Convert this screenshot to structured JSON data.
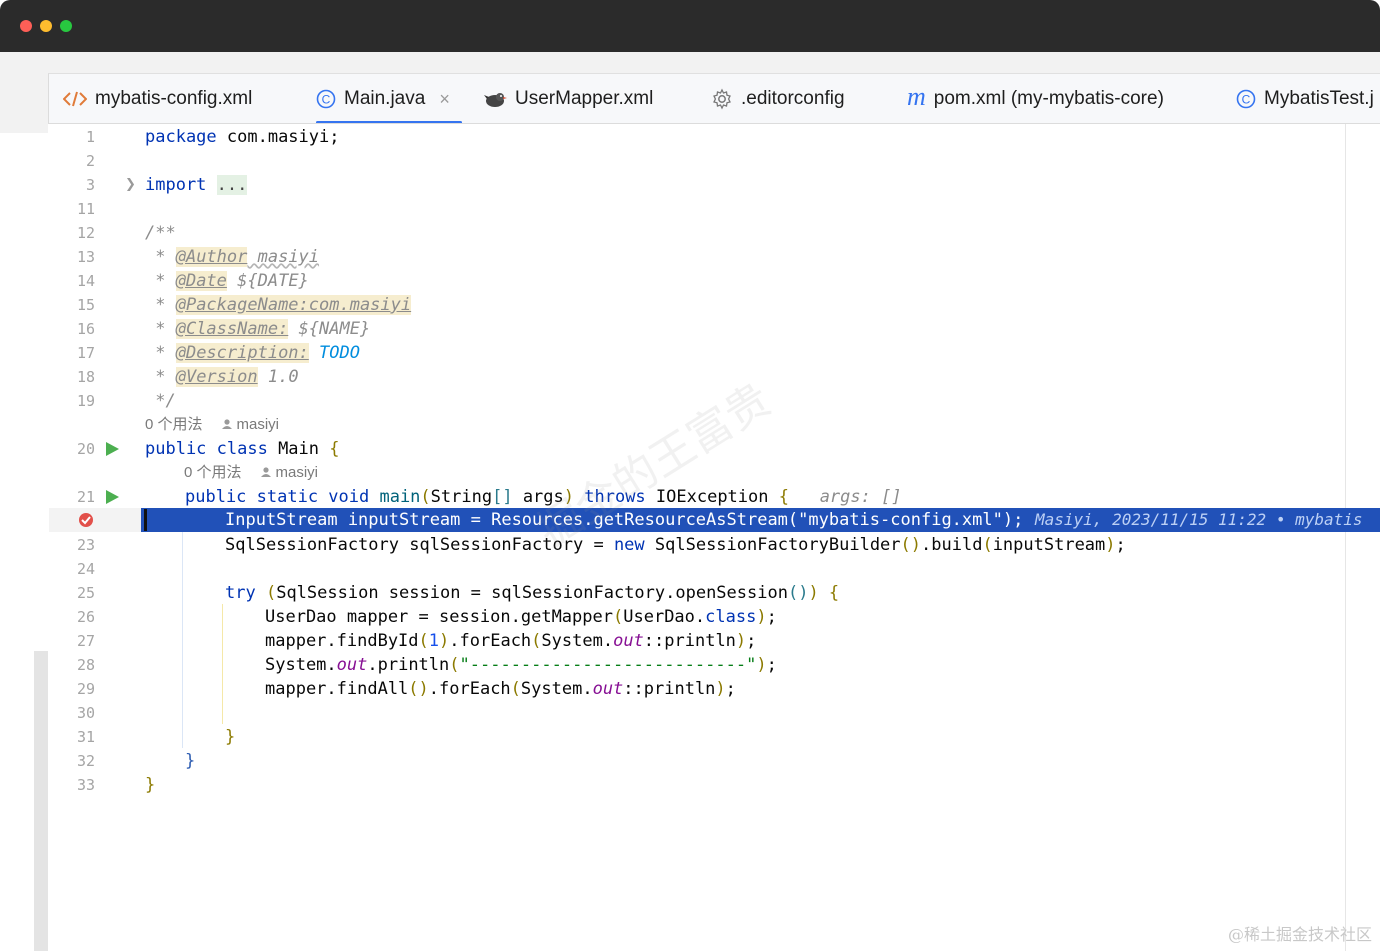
{
  "tabs": [
    {
      "label": "mybatis-config.xml",
      "icon": "xml-icon"
    },
    {
      "label": "Main.java",
      "icon": "class-icon",
      "active": true,
      "close": "×"
    },
    {
      "label": "UserMapper.xml",
      "icon": "mybatis-bird-icon"
    },
    {
      "label": ".editorconfig",
      "icon": "gear-icon"
    },
    {
      "label": "pom.xml (my-mybatis-core)",
      "icon": "maven-icon",
      "icon_text": "m"
    },
    {
      "label": "MybatisTest.j",
      "icon": "class-icon"
    }
  ],
  "line_numbers": [
    "1",
    "2",
    "3",
    "11",
    "12",
    "13",
    "14",
    "15",
    "16",
    "17",
    "18",
    "19",
    "20",
    "21",
    "23",
    "24",
    "25",
    "26",
    "27",
    "28",
    "29",
    "30",
    "31",
    "32",
    "33"
  ],
  "code": {
    "l1_kw": "package",
    "l1_rest": " com.masiyi;",
    "l3_kw": "import",
    "l3_fold": "...",
    "l12": "/**",
    "l13_star": " * ",
    "l13_tag": "@Author",
    "l13_val": " masiyi",
    "l14_star": " * ",
    "l14_tag": "@Date",
    "l14_val": " ${DATE}",
    "l15_star": " * ",
    "l15_tag": "@PackageName:com.masiyi",
    "l16_star": " * ",
    "l16_tag": "@ClassName:",
    "l16_val": " ${NAME}",
    "l17_star": " * ",
    "l17_tag": "@Description:",
    "l17_val": " TODO",
    "l18_star": " * ",
    "l18_tag": "@Version",
    "l18_val": " 1.0",
    "l19": " */",
    "hint1_usages": "0 个用法",
    "hint1_author": "masiyi",
    "l20_kw": "public class",
    "l20_rest": " Main ",
    "l20_br": "{",
    "hint2_usages": "0 个用法",
    "hint2_author": "masiyi",
    "l21_kw1": "public static void",
    "l21_name": " main",
    "l21_p1": "(",
    "l21_type": "String",
    "l21_arr": "[]",
    "l21_args": " args",
    "l21_p2": ")",
    "l21_throws": " throws",
    "l21_exc": " IOException ",
    "l21_br": "{",
    "l21_inlay": "   args: []",
    "l22": "InputStream inputStream = Resources.getResourceAsStream(\"mybatis-config.xml\");",
    "l22_blame": "Masiyi, 2023/11/15 11:22 • mybatis",
    "l23_a": "SqlSessionFactory sqlSessionFactory = ",
    "l23_new": "new",
    "l23_b": " SqlSessionFactoryBuilder",
    "l23_p": "()",
    "l23_c": ".build",
    "l23_p2": "(",
    "l23_d": "inputStream",
    "l23_p3": ")",
    "l23_e": ";",
    "l25_kw": "try",
    "l25_p": " (",
    "l25_mid": "SqlSession session = sqlSessionFactory.openSession",
    "l25_pp": "()",
    "l25_p2": ")",
    "l25_br": " {",
    "l26_a": "UserDao mapper = session.getMapper",
    "l26_p": "(",
    "l26_b": "UserDao.",
    "l26_kw": "class",
    "l26_p2": ")",
    "l26_c": ";",
    "l27_a": "mapper.findById",
    "l27_p": "(",
    "l27_n": "1",
    "l27_p2": ")",
    "l27_b": ".forEach",
    "l27_p3": "(",
    "l27_c": "System.",
    "l27_f": "out",
    "l27_d": "::println",
    "l27_p4": ")",
    "l27_e": ";",
    "l28_a": "System.",
    "l28_f": "out",
    "l28_b": ".println",
    "l28_p": "(",
    "l28_s": "\"---------------------------\"",
    "l28_p2": ")",
    "l28_e": ";",
    "l29_a": "mapper.findAll",
    "l29_pp": "()",
    "l29_b": ".forEach",
    "l29_p": "(",
    "l29_c": "System.",
    "l29_f": "out",
    "l29_d": "::println",
    "l29_p2": ")",
    "l29_e": ";",
    "l31": "}",
    "l32": "}",
    "l33": "}"
  },
  "watermark": "掘金的王富贵",
  "signature": "@稀土掘金技术社区",
  "colors": {
    "accent": "#3574f0",
    "selection": "#2151b8",
    "keyword": "#0033b3",
    "string": "#067d17",
    "run": "#4caf50"
  }
}
